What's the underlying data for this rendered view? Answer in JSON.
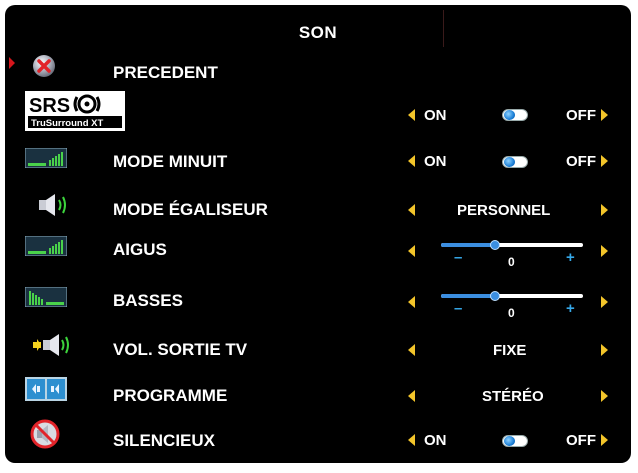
{
  "title": "SON",
  "colors": {
    "background": "#000000",
    "arrow": "#f3c52a",
    "selection": "#d6161c",
    "accent": "#3b8ee0"
  },
  "rows": [
    {
      "id": "precedent",
      "label": "PRECEDENT",
      "icon": "back-cancel-icon"
    },
    {
      "id": "srs",
      "label": "",
      "icon": "srs-trusurround-logo",
      "logo_top": "SRS",
      "logo_bottom": "TruSurround XT",
      "on_label": "ON",
      "off_label": "OFF",
      "state": "off"
    },
    {
      "id": "mode-minuit",
      "label": "MODE  MINUIT",
      "icon": "equalizer-bars-icon",
      "on_label": "ON",
      "off_label": "OFF",
      "state": "off"
    },
    {
      "id": "mode-egaliseur",
      "label": "MODE  ÉGALISEUR",
      "icon": "speaker-icon",
      "value": "PERSONNEL"
    },
    {
      "id": "aigus",
      "label": "AIGUS",
      "icon": "treble-bars-icon",
      "minus": "–",
      "plus": "+",
      "value": "0",
      "level": 0.38
    },
    {
      "id": "basses",
      "label": "BASSES",
      "icon": "bass-bars-icon",
      "minus": "–",
      "plus": "+",
      "value": "0",
      "level": 0.38
    },
    {
      "id": "vol-sortie-tv",
      "label": "VOL. SORTIE TV",
      "icon": "speaker-output-icon",
      "value": "FIXE"
    },
    {
      "id": "programme",
      "label": "PROGRAMME",
      "icon": "program-stereo-icon",
      "value": "STÉRÉO"
    },
    {
      "id": "silencieux",
      "label": "SILENCIEUX",
      "icon": "mute-icon",
      "on_label": "ON",
      "off_label": "OFF",
      "state": "off"
    }
  ]
}
